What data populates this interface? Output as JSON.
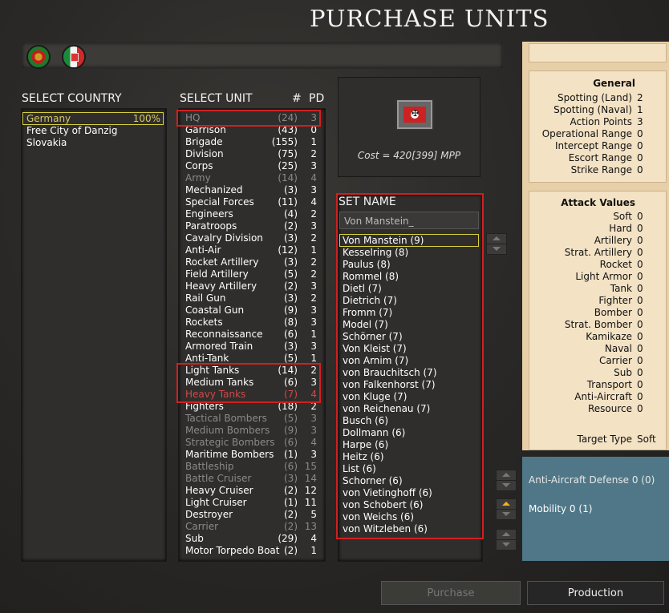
{
  "title": "PURCHASE UNITS",
  "country_panel": {
    "header": "SELECT COUNTRY",
    "countries": [
      {
        "name": "Germany",
        "pct": "100%"
      },
      {
        "name": "Free City of Danzig",
        "pct": ""
      },
      {
        "name": "Slovakia",
        "pct": ""
      }
    ]
  },
  "unit_panel": {
    "header": "SELECT UNIT",
    "count_header": "#",
    "pd_header": "PD",
    "units": [
      {
        "name": "HQ",
        "count": "(24)",
        "pd": "3",
        "state": "dim"
      },
      {
        "name": "Garrison",
        "count": "(43)",
        "pd": "0",
        "state": "normal"
      },
      {
        "name": "Brigade",
        "count": "(155)",
        "pd": "1",
        "state": "normal"
      },
      {
        "name": "Division",
        "count": "(75)",
        "pd": "2",
        "state": "normal"
      },
      {
        "name": "Corps",
        "count": "(25)",
        "pd": "3",
        "state": "normal"
      },
      {
        "name": "Army",
        "count": "(14)",
        "pd": "4",
        "state": "dim"
      },
      {
        "name": "Mechanized",
        "count": "(3)",
        "pd": "3",
        "state": "normal"
      },
      {
        "name": "Special Forces",
        "count": "(11)",
        "pd": "4",
        "state": "normal"
      },
      {
        "name": "Engineers",
        "count": "(4)",
        "pd": "2",
        "state": "normal"
      },
      {
        "name": "Paratroops",
        "count": "(2)",
        "pd": "3",
        "state": "normal"
      },
      {
        "name": "Cavalry Division",
        "count": "(3)",
        "pd": "2",
        "state": "normal"
      },
      {
        "name": "Anti-Air",
        "count": "(12)",
        "pd": "1",
        "state": "normal"
      },
      {
        "name": "Rocket Artillery",
        "count": "(3)",
        "pd": "2",
        "state": "normal"
      },
      {
        "name": "Field Artillery",
        "count": "(5)",
        "pd": "2",
        "state": "normal"
      },
      {
        "name": "Heavy Artillery",
        "count": "(2)",
        "pd": "3",
        "state": "normal"
      },
      {
        "name": "Rail Gun",
        "count": "(3)",
        "pd": "2",
        "state": "normal"
      },
      {
        "name": "Coastal Gun",
        "count": "(9)",
        "pd": "3",
        "state": "normal"
      },
      {
        "name": "Rockets",
        "count": "(8)",
        "pd": "3",
        "state": "normal"
      },
      {
        "name": "Reconnaissance",
        "count": "(6)",
        "pd": "1",
        "state": "normal"
      },
      {
        "name": "Armored Train",
        "count": "(3)",
        "pd": "3",
        "state": "normal"
      },
      {
        "name": "Anti-Tank",
        "count": "(5)",
        "pd": "1",
        "state": "normal"
      },
      {
        "name": "Light Tanks",
        "count": "(14)",
        "pd": "2",
        "state": "normal"
      },
      {
        "name": "Medium Tanks",
        "count": "(6)",
        "pd": "3",
        "state": "normal"
      },
      {
        "name": "Heavy Tanks",
        "count": "(7)",
        "pd": "4",
        "state": "red"
      },
      {
        "name": "Fighters",
        "count": "(18)",
        "pd": "2",
        "state": "normal"
      },
      {
        "name": "Tactical Bombers",
        "count": "(5)",
        "pd": "3",
        "state": "dim"
      },
      {
        "name": "Medium Bombers",
        "count": "(9)",
        "pd": "3",
        "state": "dim"
      },
      {
        "name": "Strategic Bombers",
        "count": "(6)",
        "pd": "4",
        "state": "dim"
      },
      {
        "name": "Maritime Bombers",
        "count": "(1)",
        "pd": "3",
        "state": "normal"
      },
      {
        "name": "Battleship",
        "count": "(6)",
        "pd": "15",
        "state": "dim"
      },
      {
        "name": "Battle Cruiser",
        "count": "(3)",
        "pd": "14",
        "state": "dim"
      },
      {
        "name": "Heavy Cruiser",
        "count": "(2)",
        "pd": "12",
        "state": "normal"
      },
      {
        "name": "Light Cruiser",
        "count": "(1)",
        "pd": "11",
        "state": "normal"
      },
      {
        "name": "Destroyer",
        "count": "(2)",
        "pd": "5",
        "state": "normal"
      },
      {
        "name": "Carrier",
        "count": "(2)",
        "pd": "13",
        "state": "dim"
      },
      {
        "name": "Sub",
        "count": "(29)",
        "pd": "4",
        "state": "normal"
      },
      {
        "name": "Motor Torpedo Boat",
        "count": "(2)",
        "pd": "1",
        "state": "normal"
      }
    ]
  },
  "cost_box": {
    "cost": "Cost = 420[399] MPP"
  },
  "set_name": {
    "header": "SET NAME",
    "input_value": "Von Manstein_",
    "names": [
      "Von Manstein (9)",
      "Kesselring (8)",
      "Paulus (8)",
      "Rommel (8)",
      "Dietl (7)",
      "Dietrich (7)",
      "Fromm (7)",
      "Model (7)",
      "Schörner (7)",
      "Von Kleist (7)",
      "von Arnim (7)",
      "von Brauchitsch (7)",
      "von Falkenhorst (7)",
      "von Kluge (7)",
      "von Reichenau (7)",
      "Busch (6)",
      "Dollmann (6)",
      "Harpe (6)",
      "Heitz (6)",
      "List (6)",
      "Schorner (6)",
      "von Vietinghoff (6)",
      "von Schobert (6)",
      "von Weichs (6)",
      "von Witzleben (6)"
    ]
  },
  "general": {
    "title": "General",
    "rows": [
      {
        "label": "Spotting (Land)",
        "value": "2"
      },
      {
        "label": "Spotting (Naval)",
        "value": "1"
      },
      {
        "label": "Action Points",
        "value": "3"
      },
      {
        "label": "Operational Range",
        "value": "0"
      },
      {
        "label": "Intercept Range",
        "value": "0"
      },
      {
        "label": "Escort Range",
        "value": "0"
      },
      {
        "label": "Strike Range",
        "value": "0"
      }
    ]
  },
  "attack": {
    "title": "Attack Values",
    "rows": [
      {
        "label": "Soft",
        "value": "0"
      },
      {
        "label": "Hard",
        "value": "0"
      },
      {
        "label": "Artillery",
        "value": "0"
      },
      {
        "label": "Strat. Artillery",
        "value": "0"
      },
      {
        "label": "Rocket",
        "value": "0"
      },
      {
        "label": "Light Armor",
        "value": "0"
      },
      {
        "label": "Tank",
        "value": "0"
      },
      {
        "label": "Fighter",
        "value": "0"
      },
      {
        "label": "Bomber",
        "value": "0"
      },
      {
        "label": "Strat. Bomber",
        "value": "0"
      },
      {
        "label": "Kamikaze",
        "value": "0"
      },
      {
        "label": "Naval",
        "value": "0"
      },
      {
        "label": "Carrier",
        "value": "0"
      },
      {
        "label": "Sub",
        "value": "0"
      },
      {
        "label": "Transport",
        "value": "0"
      },
      {
        "label": "Anti-Aircraft",
        "value": "0"
      },
      {
        "label": "Resource",
        "value": "0"
      }
    ],
    "target_type_label": "Target Type",
    "target_type_value": "Soft"
  },
  "defense": {
    "anti_aircraft": "Anti-Aircraft Defense 0  (0)",
    "mobility": "Mobility 0  (1)"
  },
  "buttons": {
    "purchase": "Purchase",
    "production": "Production"
  }
}
